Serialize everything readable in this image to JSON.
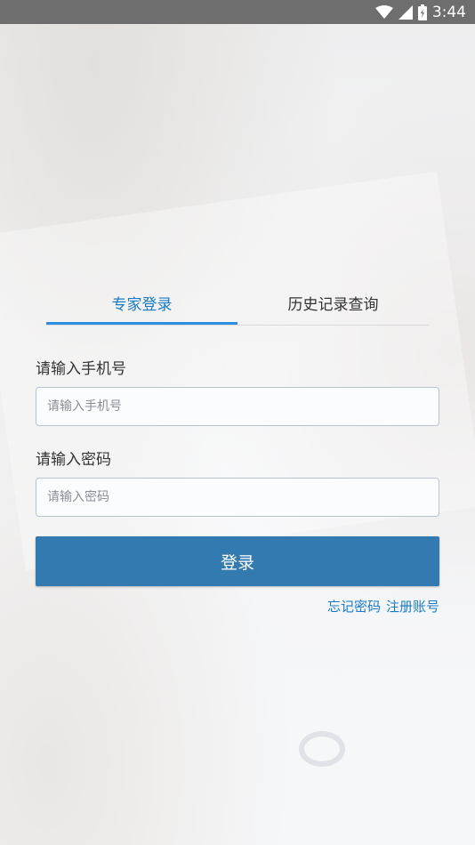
{
  "status_bar": {
    "time": "3:44",
    "icons": [
      "wifi-icon",
      "signal-icon",
      "battery-icon"
    ]
  },
  "tabs": [
    {
      "label": "专家登录",
      "active": true
    },
    {
      "label": "历史记录查询",
      "active": false
    }
  ],
  "phone": {
    "label": "请输入手机号",
    "placeholder": "请输入手机号",
    "value": ""
  },
  "password": {
    "label": "请输入密码",
    "placeholder": "请输入密码",
    "value": ""
  },
  "login_button": "登录",
  "links": {
    "forgot_password": "忘记密码",
    "register": "注册账号"
  },
  "colors": {
    "accent": "#1a7bc4",
    "button": "#337ab1",
    "status_bar": "#6e6e6e"
  }
}
